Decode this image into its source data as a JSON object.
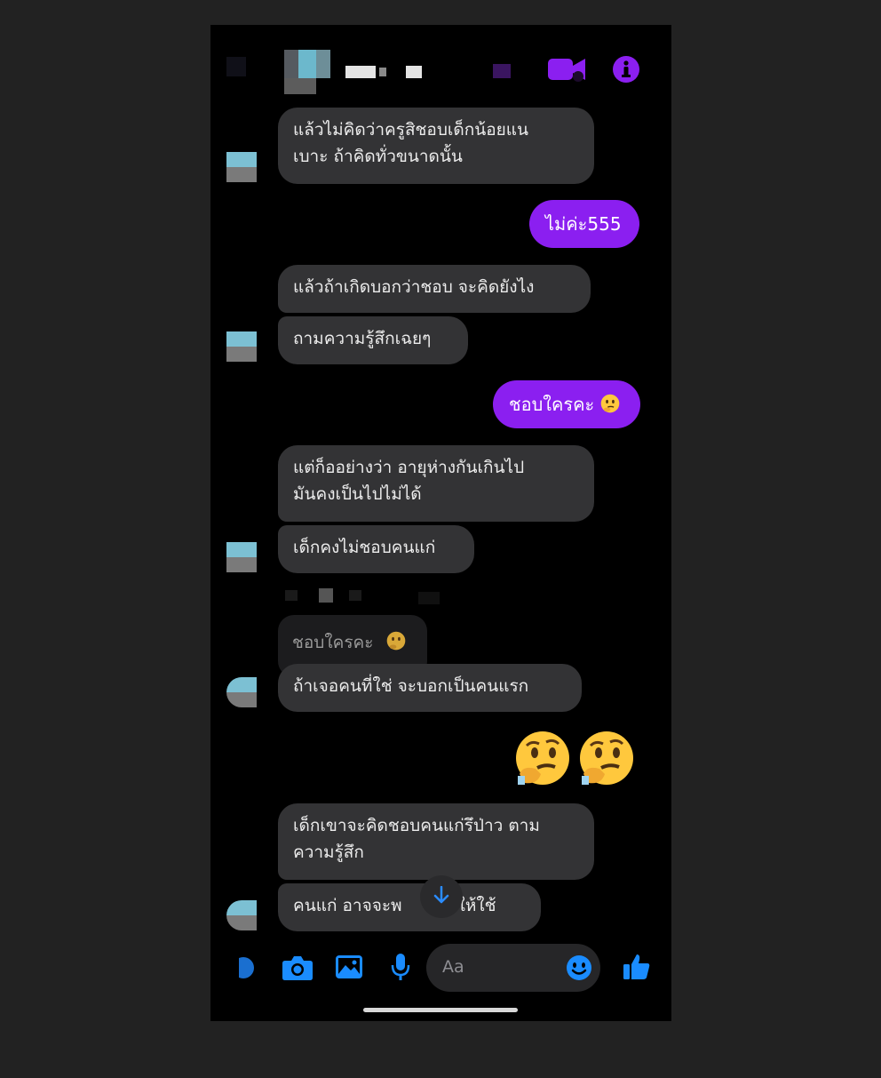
{
  "header": {
    "contact_name": "",
    "icons": [
      "video-call-icon",
      "info-icon"
    ]
  },
  "messages": [
    {
      "id": "m1",
      "direction": "in",
      "text_lines": [
        "แล้วไม่คิดว่าครูสิชอบเด็กน้อยแน",
        "เบาะ ถ้าคิดทั่วขนาดนั้น"
      ]
    },
    {
      "id": "m2",
      "direction": "out",
      "text": "ไม่ค่ะ555"
    },
    {
      "id": "m3",
      "direction": "in",
      "text": "แล้วถ้าเกิดบอกว่าชอบ จะคิดยังไง"
    },
    {
      "id": "m4",
      "direction": "in",
      "text": "ถามความรู้สึกเฉยๆ"
    },
    {
      "id": "m5",
      "direction": "out",
      "text": "ชอบใครคะ",
      "emoji": "thinking-face"
    },
    {
      "id": "m6",
      "direction": "in",
      "text_lines": [
        "แต่ก็ออย่างว่า อายุห่างกันเกินไป",
        "มันคงเป็นไปไม่ได้"
      ]
    },
    {
      "id": "m7",
      "direction": "in",
      "text": "เด็กคงไม่ชอบคนแก่"
    },
    {
      "id": "m8",
      "direction": "in",
      "reply_to": "ชอบใครคะ",
      "text": "ถ้าเจอคนที่ใช่ จะบอกเป็นคนแรก"
    },
    {
      "id": "m9",
      "direction": "out",
      "emojis": [
        "thinking-face",
        "thinking-face"
      ]
    },
    {
      "id": "m10",
      "direction": "in",
      "text_lines": [
        "เด็กเขาจะคิดชอบคนแก่รึป่าว ตาม",
        "ความรู้สึก"
      ]
    },
    {
      "id": "m11",
      "direction": "in",
      "text_parts": [
        "คนแก่ อาจจะพ",
        "งค์ให้ใช้"
      ]
    }
  ],
  "composer": {
    "placeholder": "Aa",
    "icons": [
      "camera-icon",
      "image-icon",
      "microphone-icon",
      "emoji-icon",
      "thumbs-up-icon"
    ]
  },
  "colors": {
    "accent": "#8b1ff0",
    "icon_blue": "#1a8cff",
    "incoming_bubble": "#333335",
    "background": "#000000"
  }
}
